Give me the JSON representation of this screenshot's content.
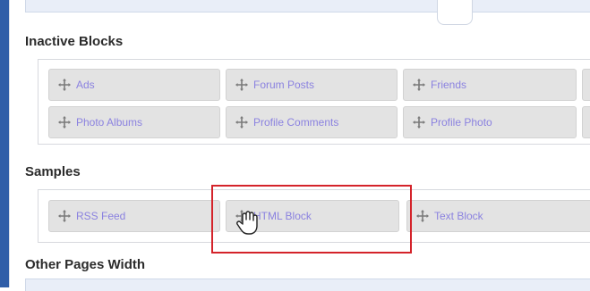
{
  "sections": {
    "inactive": {
      "title": "Inactive Blocks",
      "blocks": [
        {
          "label": "Ads",
          "icon": "move-icon"
        },
        {
          "label": "Forum Posts",
          "icon": "move-icon"
        },
        {
          "label": "Friends",
          "icon": "move-icon"
        },
        {
          "label": "Photo Albums",
          "icon": "move-icon"
        },
        {
          "label": "Profile Comments",
          "icon": "move-icon"
        },
        {
          "label": "Profile Photo",
          "icon": "move-icon"
        }
      ]
    },
    "samples": {
      "title": "Samples",
      "blocks": [
        {
          "label": "RSS Feed",
          "icon": "move-icon"
        },
        {
          "label": "HTML Block",
          "icon": "move-icon"
        },
        {
          "label": "Text Block",
          "icon": "move-icon"
        }
      ]
    },
    "other": {
      "title": "Other Pages Width"
    }
  },
  "colors": {
    "accent": "#2f5ea8",
    "block_bg": "#e3e3e3",
    "block_text": "#8b82e0",
    "highlight": "#d4232a"
  },
  "cursor": "drag-hand-cursor-icon"
}
